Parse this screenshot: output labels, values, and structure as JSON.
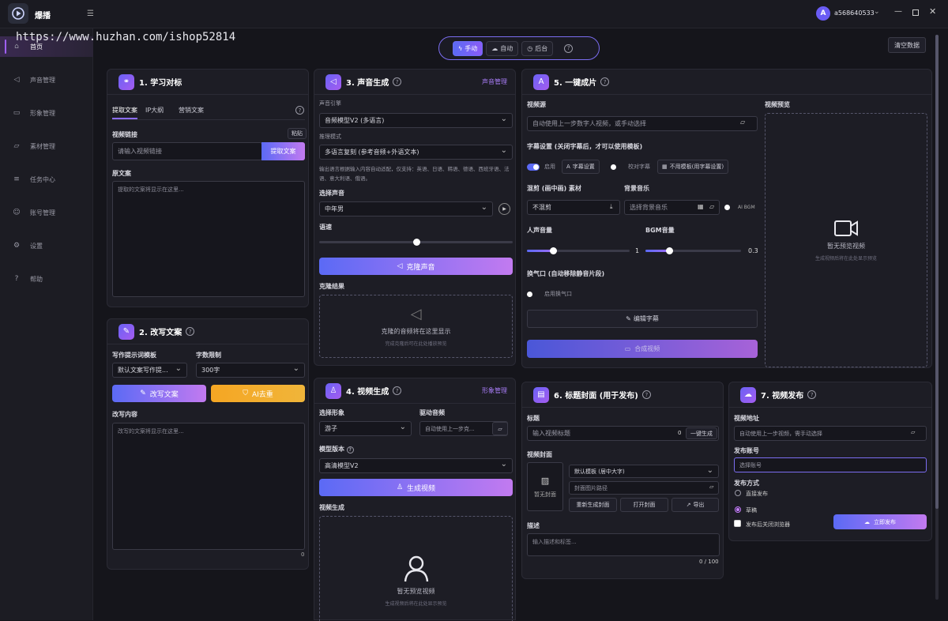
{
  "app": {
    "title": "爆播",
    "user": "a568640533",
    "avatar_letter": "A"
  },
  "watermark": "https://www.huzhan.com/ishop52814",
  "sidebar": {
    "items": [
      {
        "label": "首页",
        "icon": "home-icon"
      },
      {
        "label": "声音管理",
        "icon": "speaker-icon"
      },
      {
        "label": "形象管理",
        "icon": "video-icon"
      },
      {
        "label": "素材管理",
        "icon": "folder-icon"
      },
      {
        "label": "任务中心",
        "icon": "list-icon"
      },
      {
        "label": "账号管理",
        "icon": "user-icon"
      },
      {
        "label": "设置",
        "icon": "gear-icon"
      },
      {
        "label": "帮助",
        "icon": "help-icon"
      }
    ]
  },
  "modes": {
    "manual": "手动",
    "auto": "自动",
    "background": "后台",
    "clear": "清空数据"
  },
  "c1": {
    "title": "1. 学习对标",
    "tabs": [
      "提取文案",
      "IP大纲",
      "营销文案"
    ],
    "link_label": "视频链接",
    "paste": "粘贴",
    "link_placeholder": "请输入视频链接",
    "extract": "提取文案",
    "orig_label": "原文案",
    "orig_placeholder": "提取的文案将显示在这里..."
  },
  "c2": {
    "title": "2. 改写文案",
    "tpl_label": "写作提示词模板",
    "tpl_value": "默认文案写作提...",
    "count_label": "字数限制",
    "count_value": "300字",
    "rewrite": "改写文案",
    "ai": "AI去重",
    "content_label": "改写内容",
    "content_placeholder": "改写的文案将显示在这里...",
    "counter": "0"
  },
  "c3": {
    "title": "3. 声音生成",
    "link": "声音管理",
    "engine_label": "声音引擎",
    "engine_value": "音频模型V2 (多语言)",
    "mode_label": "推理模式",
    "mode_value": "多语言复刻 (参考音频+外语文本)",
    "note": "输出语言根据输入内容自动适配，仅支持：英语、日语、韩语、德语、西班牙语、法语、意大利语、俄语。",
    "voice_label": "选择声音",
    "voice_value": "中年男",
    "speed_label": "语速",
    "speed_value": 0.5,
    "clone": "克隆声音",
    "result_label": "克隆结果",
    "ph_title": "克隆的音频将在这里显示",
    "ph_sub": "完成克隆后可在此处播放预览"
  },
  "c4": {
    "title": "4. 视频生成",
    "link": "形象管理",
    "avatar_label": "选择形象",
    "avatar_value": "游子",
    "drive_label": "驱动音频",
    "drive_placeholder": "自动使用上一步克...",
    "model_label": "模型版本",
    "model_value": "高清模型V2",
    "generate": "生成视频",
    "gen_label": "视频生成",
    "ph_title": "暂无预览视频",
    "ph_sub": "生成视频后将在此处显示预览"
  },
  "c5": {
    "title": "5. 一键成片",
    "video_label": "视频源",
    "video_placeholder": "自动使用上一步数字人视频，或手动选择",
    "preview_label": "视频预览",
    "preview_title": "暂无预览视频",
    "preview_sub": "生成视频后将在此处显示预览",
    "sub_label": "字幕设置 (关闭字幕后，才可以使用模板)",
    "enable": "启用",
    "sub_settings": "字幕设置",
    "proof": "校对字幕",
    "no_template": "不用模板(用字幕设置)",
    "pip_label": "混剪 (画中画) 素材",
    "pip_value": "不混剪",
    "bgm_label": "背景音乐",
    "bgm_placeholder": "选择背景音乐",
    "ai_bgm": "AI BGM",
    "vol_label": "人声音量",
    "vol_value": 1,
    "bgm_vol_label": "BGM音量",
    "bgm_vol_value": 0.3,
    "breath_label": "换气口 (自动移除静音片段)",
    "breath_enable": "启用换气口",
    "edit_sub": "编辑字幕",
    "compose": "合成视频"
  },
  "c6": {
    "title": "6. 标题封面 (用于发布)",
    "title_label": "标题",
    "title_placeholder": "输入视频标题",
    "title_count": "0",
    "one_click": "一键生成",
    "cover_label": "视频封面",
    "no_cover": "暂无封面",
    "template": "默认模板 (居中大字)",
    "bg_path": "封面图片路径",
    "regen": "重新生成封面",
    "open": "打开封面",
    "export": "导出",
    "desc_label": "描述",
    "desc_placeholder": "输入描述和标签...",
    "desc_count": "0 / 100"
  },
  "c7": {
    "title": "7. 视频发布",
    "addr_label": "视频地址",
    "addr_placeholder": "自动使用上一步视频，需手动选择",
    "account_label": "发布账号",
    "account_placeholder": "选择账号",
    "method_label": "发布方式",
    "direct": "直接发布",
    "draft": "草稿",
    "close_browser": "发布后关闭浏览器",
    "publish": "立即发布"
  }
}
